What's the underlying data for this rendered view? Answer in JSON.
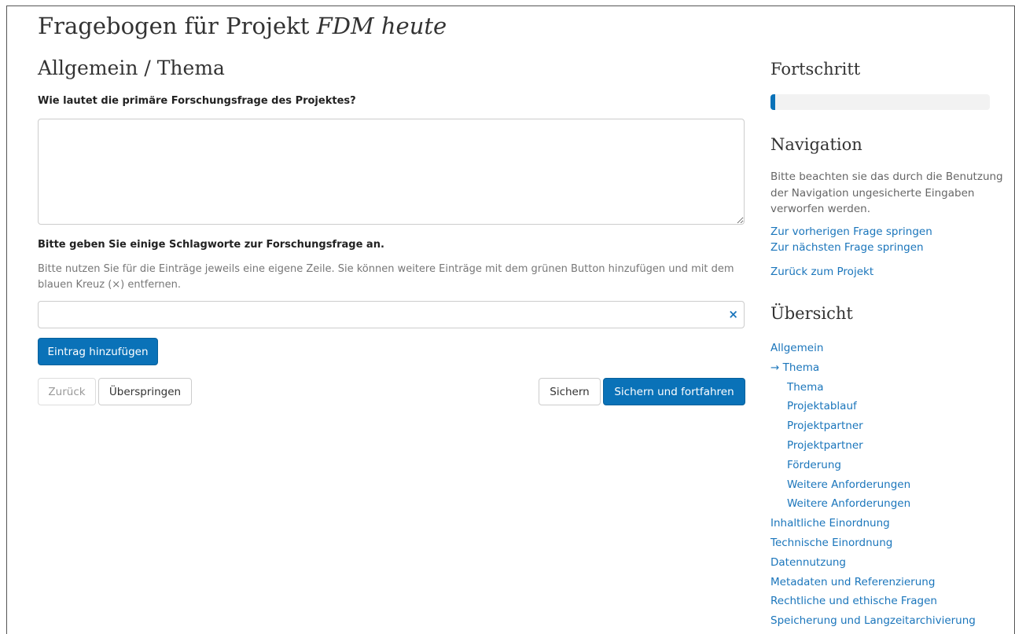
{
  "header": {
    "title_prefix": "Fragebogen für Projekt",
    "project_name": "FDM heute"
  },
  "section": {
    "title": "Allgemein / Thema"
  },
  "questions": {
    "q1": {
      "label": "Wie lautet die primäre Forschungsfrage des Projektes?",
      "value": ""
    },
    "q2": {
      "label": "Bitte geben Sie einige Schlagworte zur Forschungsfrage an.",
      "help": "Bitte nutzen Sie für die Einträge jeweils eine eigene Zeile. Sie können weitere Einträge mit dem grünen Button hinzufügen und mit dem blauen Kreuz (×) entfernen.",
      "entries": [
        ""
      ],
      "remove_icon": "×"
    }
  },
  "buttons": {
    "add_entry": "Eintrag hinzufügen",
    "back": "Zurück",
    "skip": "Überspringen",
    "save": "Sichern",
    "save_continue": "Sichern und fortfahren"
  },
  "sidebar": {
    "progress": {
      "title": "Fortschritt",
      "percent": 2
    },
    "navigation": {
      "title": "Navigation",
      "note": "Bitte beachten sie das durch die Benutzung der Navigation ungesicherte Eingaben verworfen werden.",
      "prev_link": "Zur vorherigen Frage springen",
      "next_link": "Zur nächsten Frage springen",
      "project_link": "Zurück zum Projekt"
    },
    "overview": {
      "title": "Übersicht",
      "items": [
        {
          "label": "Allgemein",
          "level": 0
        },
        {
          "label": "→ Thema",
          "level": 0,
          "current": true
        },
        {
          "label": "Thema",
          "level": 1
        },
        {
          "label": "Projektablauf",
          "level": 1
        },
        {
          "label": "Projektpartner",
          "level": 1
        },
        {
          "label": "Projektpartner",
          "level": 1
        },
        {
          "label": "Förderung",
          "level": 1
        },
        {
          "label": "Weitere Anforderungen",
          "level": 1
        },
        {
          "label": "Weitere Anforderungen",
          "level": 1
        },
        {
          "label": "Inhaltliche Einordnung",
          "level": 0
        },
        {
          "label": "Technische Einordnung",
          "level": 0
        },
        {
          "label": "Datennutzung",
          "level": 0
        },
        {
          "label": "Metadaten und Referenzierung",
          "level": 0
        },
        {
          "label": "Rechtliche und ethische Fragen",
          "level": 0
        },
        {
          "label": "Speicherung und Langzeitarchivierung",
          "level": 0
        }
      ]
    }
  },
  "colors": {
    "accent": "#0a72b8",
    "link": "#1a75bb"
  }
}
